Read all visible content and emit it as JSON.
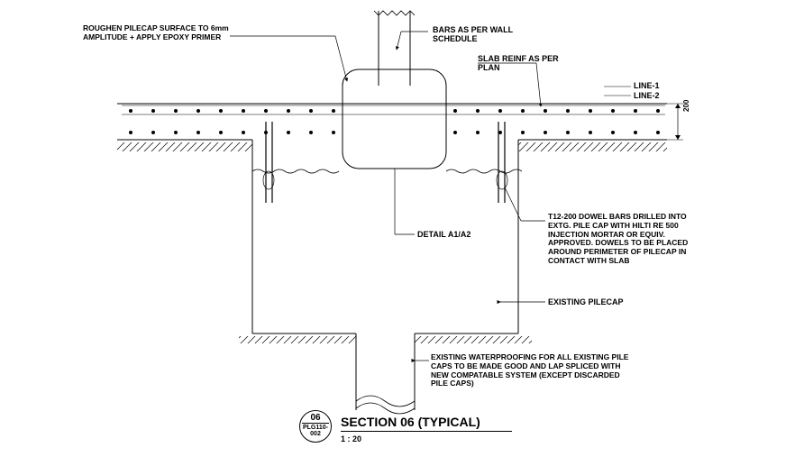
{
  "notes": {
    "roughen": "ROUGHEN PILECAP SURFACE TO 6mm AMPLITUDE + APPLY EPOXY PRIMER",
    "bars_wall": "BARS AS PER WALL SCHEDULE",
    "slab_reinf": "SLAB REINF AS PER PLAN",
    "line1": "LINE-1",
    "line2": "LINE-2",
    "detail_ref": "DETAIL A1/A2",
    "dowel_bars": "T12-200 DOWEL BARS DRILLED INTO EXTG. PILE CAP WITH HILTI RE 500 INJECTION MORTAR OR EQUIV. APPROVED. DOWELS TO BE PLACED AROUND PERIMETER OF PILECAP IN CONTACT WITH SLAB",
    "existing_pilecap": "EXISTING PILECAP",
    "waterproofing": "EXISTING WATERPROOFING FOR ALL EXISTING PILE CAPS TO BE MADE GOOD AND LAP SPLICED WITH NEW COMPATABLE SYSTEM (EXCEPT DISCARDED PILE CAPS)",
    "slab_dim": "200"
  },
  "title": {
    "name": "SECTION 06 (TYPICAL)",
    "number": "06",
    "dwg_ref": "PLG110-002",
    "scale": "1 : 20"
  },
  "chart_data": {
    "type": "diagram",
    "description": "Structural section detail through existing pilecap with new slab and wall connection",
    "elements": [
      {
        "name": "wall",
        "note": "bars as per wall schedule"
      },
      {
        "name": "slab",
        "thickness_mm": 200,
        "reinf": "as per plan",
        "lines": [
          "LINE-1",
          "LINE-2"
        ]
      },
      {
        "name": "pilecap",
        "status": "existing",
        "surface_prep": "roughen to 6mm amplitude + epoxy primer"
      },
      {
        "name": "dowel_bars",
        "spec": "T12-200",
        "anchor": "Hilti RE 500 injection mortar or equiv",
        "placement": "around perimeter of pilecap in contact with slab"
      },
      {
        "name": "pile",
        "status": "existing"
      },
      {
        "name": "waterproofing",
        "status": "existing, make good and lap splice with new compatible system"
      },
      {
        "name": "detail_ref",
        "value": "A1/A2"
      }
    ],
    "section_number": "06",
    "scale": "1:20",
    "drawing_ref": "PLG110-002"
  }
}
